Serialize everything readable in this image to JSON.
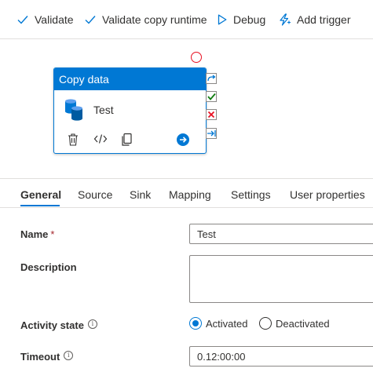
{
  "toolbar": {
    "validate": "Validate",
    "validate_copy_runtime": "Validate copy runtime",
    "debug": "Debug",
    "add_trigger": "Add trigger"
  },
  "activity": {
    "type": "Copy data",
    "name": "Test"
  },
  "tabs": [
    "General",
    "Source",
    "Sink",
    "Mapping",
    "Settings",
    "User properties"
  ],
  "active_tab": "General",
  "form": {
    "name_label": "Name",
    "name_required_mark": "*",
    "name_value": "Test",
    "description_label": "Description",
    "description_value": "",
    "activity_state_label": "Activity state",
    "activity_state_options": [
      "Activated",
      "Deactivated"
    ],
    "activity_state_selected": "Activated",
    "timeout_label": "Timeout",
    "timeout_value": "0.12:00:00",
    "info_glyph": "i"
  },
  "colors": {
    "accent": "#0078d4",
    "success": "#107c10",
    "error": "#e81123",
    "text": "#323130"
  },
  "icons": [
    "checkmark-icon",
    "play-outline-icon",
    "lightning-icon",
    "database-icon",
    "delete-icon",
    "code-icon",
    "copy-icon",
    "arrow-right-circle-icon",
    "redo-icon",
    "success-check-icon",
    "failure-x-icon",
    "completion-arrow-icon",
    "breakpoint-circle-icon"
  ]
}
